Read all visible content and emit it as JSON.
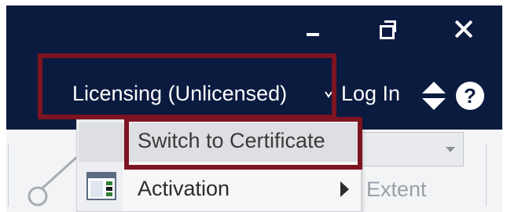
{
  "window_controls": {
    "minimize_icon": "minimize-icon",
    "restore_icon": "restore-icon",
    "close_icon": "close-icon"
  },
  "header": {
    "licensing_label": "Licensing (Unlicensed)",
    "licensing_chevron_icon": "chevron-down-icon",
    "login_label": "Log In",
    "updown_icon": "up-down-icon",
    "help_label": "?"
  },
  "menu": {
    "items": [
      {
        "label": "Switch to Certificate",
        "highlighted": true
      },
      {
        "label": "Activation",
        "icon": "activation-icon",
        "has_submenu": true
      }
    ]
  },
  "ribbon": {
    "extent_label": "Extent"
  },
  "colors": {
    "titlebar": "#0b1a3f",
    "annotation_border": "#7d1421",
    "menu_highlight": "#dedfe2"
  }
}
